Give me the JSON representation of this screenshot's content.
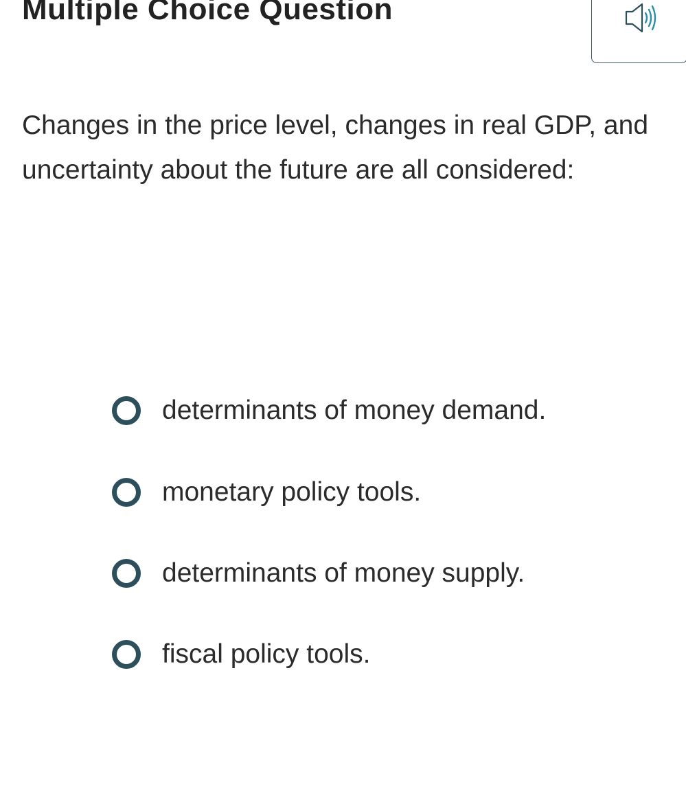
{
  "header": {
    "title": "Multiple Choice Question",
    "audio_icon": "speaker-icon"
  },
  "question": {
    "text": "Changes in the price level, changes in real GDP, and uncertainty about the future are all considered:"
  },
  "options": [
    {
      "label": "determinants of money demand."
    },
    {
      "label": "monetary policy tools."
    },
    {
      "label": "determinants of money supply."
    },
    {
      "label": "fiscal policy tools."
    }
  ],
  "colors": {
    "radio_border": "#2d4f5b",
    "speaker_outline": "#2d4f5b",
    "speaker_waves": "#2a8fa6",
    "text": "#2b2b2b"
  }
}
